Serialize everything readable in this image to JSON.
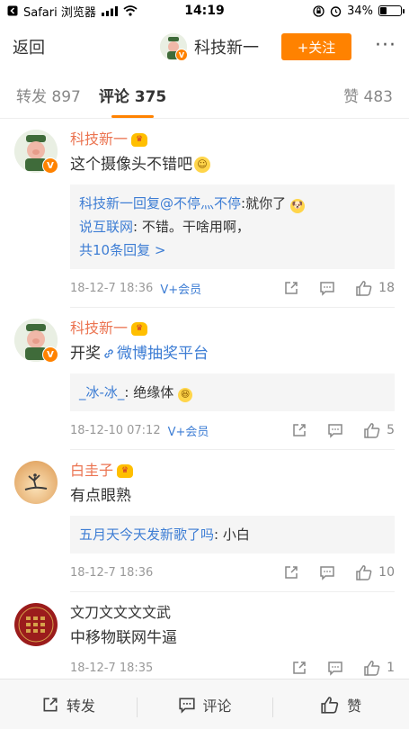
{
  "status_bar": {
    "carrier": "Safari 浏览器",
    "time": "14:19",
    "battery": "34%",
    "battery_level": 0.34
  },
  "nav": {
    "back": "返回",
    "title": "科技新一",
    "follow": "+关注",
    "more": "···"
  },
  "tabs": {
    "repost": "转发 897",
    "comments": "评论 375",
    "likes": "赞 483"
  },
  "comments": [
    {
      "name": "科技新一",
      "text": "这个摄像头不错吧",
      "replies": [
        {
          "user": "科技新一回复@不停灬不停",
          "text": ":就你了"
        },
        {
          "user": "说互联网",
          "text": ": 不错。干啥用啊，"
        }
      ],
      "more_replies": "共10条回复 >",
      "time": "18-12-7 18:36",
      "vip": "V+会员",
      "like_count": "18"
    },
    {
      "name": "科技新一",
      "text_prefix": "开奖",
      "text_link": "微博抽奖平台",
      "replies": [
        {
          "user": "_冰-冰_",
          "text": ": 绝缘体"
        }
      ],
      "time": "18-12-10 07:12",
      "vip": "V+会员",
      "like_count": "5"
    },
    {
      "name": "白圭子",
      "text": "有点眼熟",
      "replies": [
        {
          "user": "五月天今天发新歌了吗",
          "text": ": 小白"
        }
      ],
      "time": "18-12-7 18:36",
      "like_count": "10"
    },
    {
      "name": "文刀文文文文武",
      "text": "中移物联网牛逼",
      "time": "18-12-7 18:35",
      "like_count": "1"
    }
  ],
  "bottom_bar": {
    "repost": "转发",
    "comment": "评论",
    "like": "赞"
  },
  "colors": {
    "accent": "#ff8200",
    "link": "#3d7dd4",
    "username": "#eb7350"
  }
}
